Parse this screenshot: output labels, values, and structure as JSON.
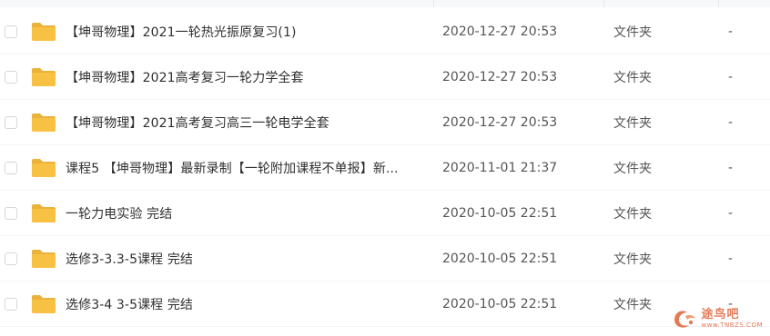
{
  "files": [
    {
      "name": "【坤哥物理】2021一轮热光振原复习(1)",
      "modified": "2020-12-27 20:53",
      "type": "文件夹",
      "size": "-",
      "icon": "folder-icon"
    },
    {
      "name": "【坤哥物理】2021高考复习一轮力学全套",
      "modified": "2020-12-27 20:53",
      "type": "文件夹",
      "size": "-",
      "icon": "folder-icon"
    },
    {
      "name": "【坤哥物理】2021高考复习高三一轮电学全套",
      "modified": "2020-12-27 20:53",
      "type": "文件夹",
      "size": "-",
      "icon": "folder-icon"
    },
    {
      "name": "课程5 【坤哥物理】最新录制【一轮附加课程不单报】新...",
      "modified": "2020-11-01 21:37",
      "type": "文件夹",
      "size": "-",
      "icon": "folder-icon"
    },
    {
      "name": "一轮力电实验 完结",
      "modified": "2020-10-05 22:51",
      "type": "文件夹",
      "size": "-",
      "icon": "folder-icon"
    },
    {
      "name": "选修3-3.3-5课程 完结",
      "modified": "2020-10-05 22:51",
      "type": "文件夹",
      "size": "-",
      "icon": "folder-icon"
    },
    {
      "name": "选修3-4 3-5课程 完结",
      "modified": "2020-10-05 22:51",
      "type": "文件夹",
      "size": "-",
      "icon": "folder-icon"
    }
  ],
  "watermark": {
    "name": "途鸟吧",
    "url": "www.TNBZS.COM"
  },
  "colors": {
    "folder": "#f7c244",
    "folder_tab": "#eab23a",
    "watermark": "#e0623a"
  }
}
